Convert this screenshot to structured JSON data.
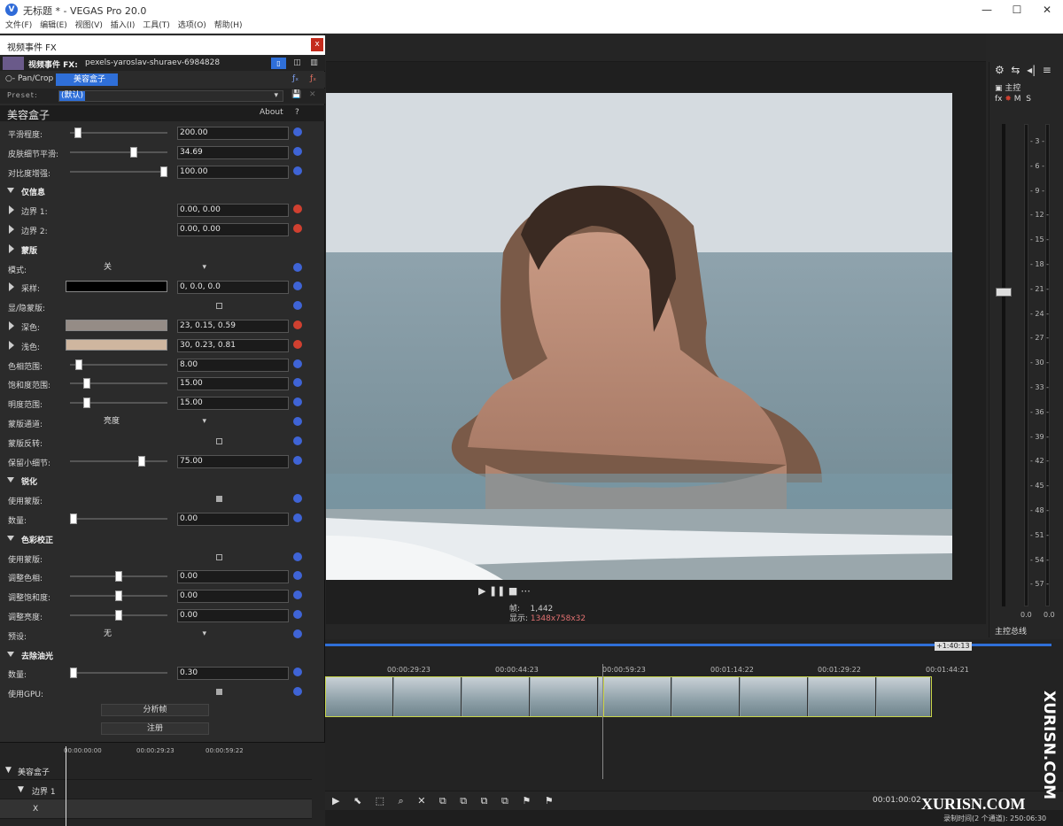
{
  "window": {
    "title": "无标题 * - VEGAS Pro 20.0",
    "logo": "V"
  },
  "menu": [
    "文件(F)",
    "编辑(E)",
    "视图(V)",
    "插入(I)",
    "工具(T)",
    "选项(O)",
    "帮助(H)"
  ],
  "fx_window": {
    "title": "视频事件 FX",
    "close": "x",
    "header_label": "视频事件 FX:",
    "media_name": "pexels-yaroslav-shuraev-6984828",
    "chain": {
      "first": "○- Pan/Crop -",
      "second": "美容盒子"
    },
    "preset_label": "Preset:",
    "preset_value": "(默认)",
    "plugin_name": "美容盒子",
    "about": "About",
    "help": "?",
    "params": [
      {
        "label": "平滑程度:",
        "value": "200.00"
      },
      {
        "label": "皮肤细节平滑:",
        "value": "34.69"
      },
      {
        "label": "对比度增强:",
        "value": "100.00"
      },
      {
        "label": "仅信息"
      },
      {
        "label": "边界 1:",
        "value": "0.00, 0.00"
      },
      {
        "label": "边界 2:",
        "value": "0.00, 0.00"
      },
      {
        "label": "蒙版"
      },
      {
        "label": "模式:",
        "value": "关"
      },
      {
        "label": "采样:",
        "value": "0, 0.0, 0.0"
      },
      {
        "label": "显/隐蒙版:"
      },
      {
        "label": "深色:",
        "value": "23, 0.15, 0.59"
      },
      {
        "label": "浅色:",
        "value": "30, 0.23, 0.81"
      },
      {
        "label": "色相范围:",
        "value": "8.00"
      },
      {
        "label": "饱和度范围:",
        "value": "15.00"
      },
      {
        "label": "明度范围:",
        "value": "15.00"
      },
      {
        "label": "蒙版通道:",
        "value": "亮度"
      },
      {
        "label": "蒙版反转:"
      },
      {
        "label": "保留小细节:",
        "value": "75.00"
      },
      {
        "label": "锐化"
      },
      {
        "label": "使用蒙版:"
      },
      {
        "label": "数量:",
        "value": "0.00"
      },
      {
        "label": "色彩校正"
      },
      {
        "label": "使用蒙版:"
      },
      {
        "label": "调整色相:",
        "value": "0.00"
      },
      {
        "label": "调整饱和度:",
        "value": "0.00"
      },
      {
        "label": "调整亮度:",
        "value": "0.00"
      },
      {
        "label": "预设:",
        "value": "无"
      },
      {
        "label": "去除油光"
      },
      {
        "label": "数量:",
        "value": "0.30"
      },
      {
        "label": "使用GPU:"
      }
    ],
    "buttons": {
      "analyze": "分析帧",
      "register": "注册"
    },
    "slider_levels": {
      "smooth": 0.05,
      "skin": 0.67,
      "contrast": 1.0,
      "hue": 0.06,
      "sat": 0.15,
      "light": 0.15,
      "detail": 0.75,
      "amount": 0.0,
      "adj_hue": 0.5,
      "adj_sat": 0.5,
      "adj_light": 0.5,
      "oil": 0.0
    },
    "swatch_colors": {
      "sample": "#000000",
      "dark": "#958c86",
      "light": "#cfb69f"
    },
    "keyframes": {
      "ruler": [
        "00:00:00:00",
        "00:00:29:23",
        "00:00:59:22"
      ],
      "tracks": [
        "美容盒子",
        "边界 1",
        "X"
      ]
    }
  },
  "preview": {
    "transport": "▶ ❚❚ ■ ⋯",
    "frame_label": "帧:",
    "frame_value": "1,442",
    "display_label": "显示:",
    "display_value": "1348x758x32"
  },
  "master": {
    "title": "主控",
    "fx": "fx",
    "m": "M",
    "s": "S",
    "scale": [
      "3",
      "6",
      "9",
      "12",
      "15",
      "18",
      "21",
      "24",
      "27",
      "30",
      "33",
      "36",
      "39",
      "42",
      "45",
      "48",
      "51",
      "54",
      "57"
    ],
    "readout_left": "0.0",
    "readout_right": "0.0",
    "bus_label": "主控总线"
  },
  "timeline": {
    "marker": "+1:40:13",
    "ruler": [
      "00:00:29:23",
      "00:00:44:23",
      "00:00:59:23",
      "00:01:14:22",
      "00:01:29:22",
      "00:01:44:21"
    ],
    "time": "00:01:00:02",
    "status": "录制时间(2 个通道): 250:06:30"
  },
  "watermark": {
    "vertical": "XURISN.COM",
    "horizontal": "XURISN.COM"
  },
  "colors": {
    "accent": "#2f6fd8",
    "kf_blue": "#3f64d6",
    "kf_red": "#d04030"
  }
}
